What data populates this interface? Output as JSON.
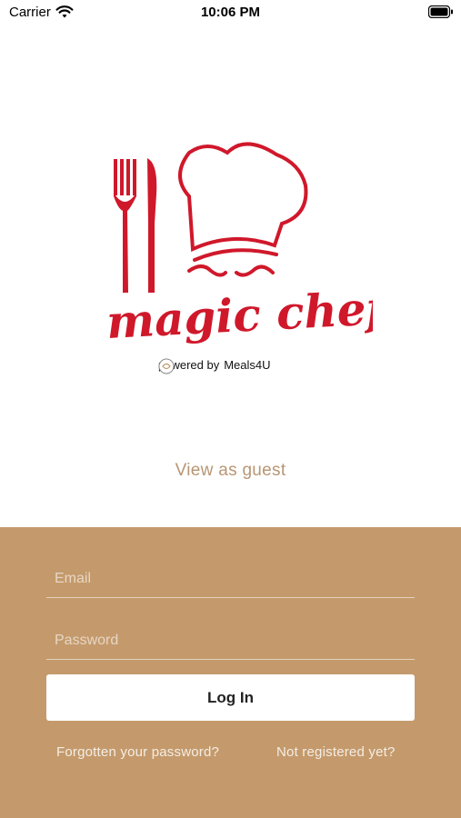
{
  "status_bar": {
    "carrier": "Carrier",
    "time": "10:06 PM"
  },
  "logo": {
    "brand_name": "magic chef",
    "powered_by": "powered by",
    "partner_name": "Meals4U",
    "colors": {
      "brand_red": "#d0182b"
    }
  },
  "guest": {
    "label": "View as guest"
  },
  "login": {
    "email_placeholder": "Email",
    "password_placeholder": "Password",
    "button_label": "Log In",
    "forgot_label": "Forgotten your password?",
    "register_label": "Not registered yet?"
  },
  "colors": {
    "panel_bg": "#c49a6c",
    "guest_text": "#b89673"
  }
}
